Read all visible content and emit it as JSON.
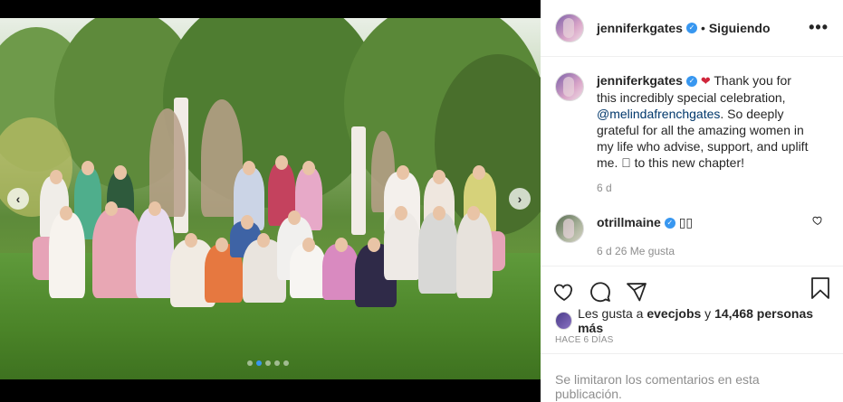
{
  "header": {
    "username": "jenniferkgates",
    "separator": "•",
    "follow_status": "Siguiendo",
    "more": "•••"
  },
  "post": {
    "username": "jenniferkgates",
    "caption_before": " Thank you for this incredibly special celebration, ",
    "mention": "@melindafrenchgates",
    "caption_after": ". So deeply grateful for all the amazing women in my life who advise, support, and uplift me. 🏿 to this new chapter!",
    "age": "6 d"
  },
  "comment": {
    "username": "otrillmaine",
    "text": "▯▯",
    "meta": "6 d    26 Me gusta"
  },
  "likes": {
    "prefix": "Les gusta a ",
    "liker": "evecjobs",
    "middle": " y ",
    "count": "14,468 personas más"
  },
  "timestamp": "HACE 6 DÍAS",
  "comments_disabled": "Se limitaron los comentarios en esta publicación.",
  "carousel": {
    "prev": "‹",
    "next": "›",
    "dots": 5,
    "active_dot": 1
  },
  "colors": {
    "verified": "#3897f0",
    "mention": "#00376b",
    "muted": "#8e8e8e"
  }
}
